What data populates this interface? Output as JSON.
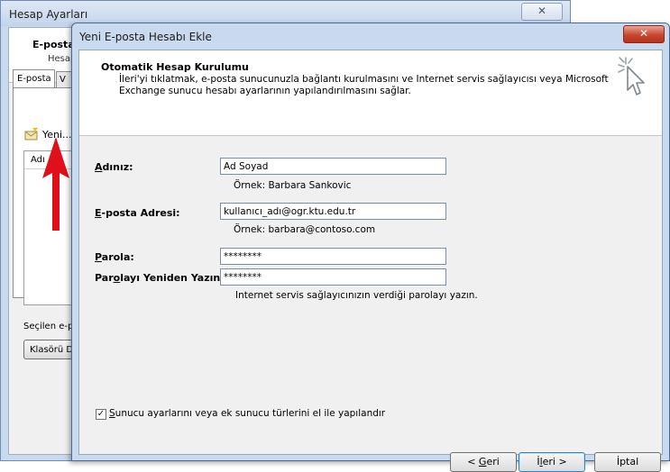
{
  "background_window": {
    "title": "Hesap Ayarları",
    "close_glyph": "✕",
    "header_title": "E-posta",
    "header_subtitle": "Hesap",
    "tabs": [
      "E-posta",
      "V"
    ],
    "new_label": "Yeni...",
    "list_column": "Adı",
    "selected_label": "Seçilen e-po",
    "folder_button": "Klasörü D"
  },
  "dialog": {
    "title": "Yeni E-posta Hesabı Ekle",
    "close_glyph": "✕",
    "header": {
      "title": "Otomatik Hesap Kurulumu",
      "description": "İleri'yi tıklatmak, e-posta sunucunuzla bağlantı kurulmasını ve Internet servis sağlayıcısı veya Microsoft Exchange sunucu hesabı ayarlarının yapılandırılmasını sağlar."
    },
    "fields": {
      "name": {
        "label_u": "A",
        "label_rest": "dınız:",
        "value": "Ad Soyad",
        "example": "Örnek: Barbara Sankovic"
      },
      "email": {
        "label_u": "E",
        "label_rest": "-posta Adresi:",
        "value": "kullanıcı_adı@ogr.ktu.edu.tr",
        "example": "Örnek: barbara@contoso.com"
      },
      "password": {
        "label_u": "P",
        "label_rest": "arola:",
        "value": "********"
      },
      "password_confirm": {
        "label_pre": "Par",
        "label_u": "o",
        "label_rest": "layı Yeniden Yazın:",
        "value": "********",
        "hint": "Internet servis sağlayıcınızın verdiği parolayı yazın."
      }
    },
    "manual_config": {
      "checked": true,
      "label_u": "S",
      "label_rest": "unucu ayarlarını veya ek sunucu türlerini el ile yapılandır"
    },
    "buttons": {
      "back_pre": "< ",
      "back_u": "G",
      "back_rest": "eri",
      "next_pre": "İ",
      "next_u": "l",
      "next_rest": "eri >",
      "cancel": "İptal"
    }
  },
  "colors": {
    "arrow": "#e0101b",
    "dialog_frame": "#c9daef",
    "close_button": "#c9452d"
  }
}
